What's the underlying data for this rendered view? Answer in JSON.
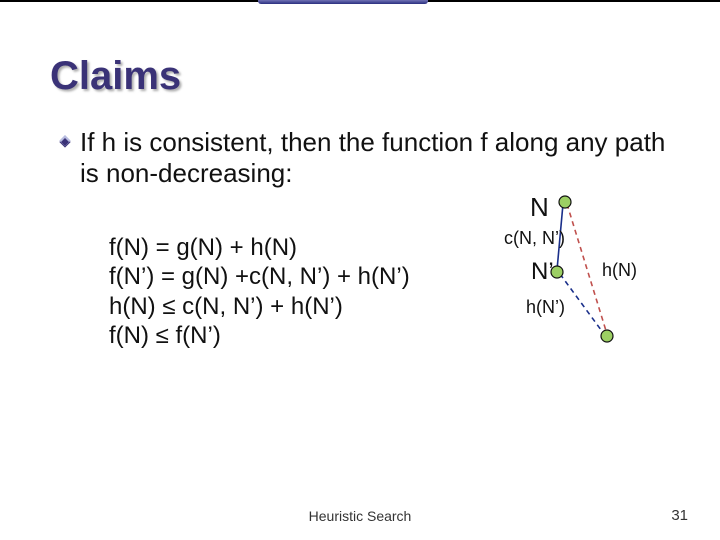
{
  "slide": {
    "title": "Claims",
    "bullet": "If h is consistent, then the function f along any path is non-decreasing:",
    "proof": {
      "l1": "f(N) = g(N) + h(N)",
      "l2": "f(N’) = g(N) +c(N, N’) + h(N’)",
      "l3_lhs": "h(N) ",
      "l3_rhs": " c(N, N’) + h(N’)",
      "l4_lhs": "f(N) ",
      "l4_rhs": " f(N’)"
    },
    "labels": {
      "N": "N",
      "cNN": "c(N, N’)",
      "Nprime": "N’",
      "hN": "h(N)",
      "hNprime": "h(N’)"
    },
    "footer": "Heuristic Search",
    "page": "31",
    "colors": {
      "title": "#3a3277",
      "node_fill": "#9ccf63",
      "node_stroke": "#111111",
      "edge_blue": "#1a2f8a",
      "edge_red": "#c0504d"
    }
  }
}
